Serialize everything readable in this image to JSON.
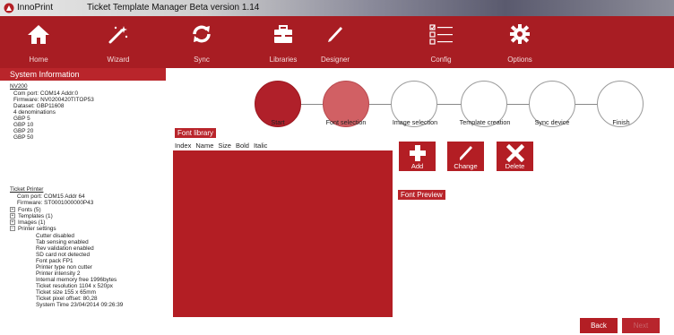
{
  "titlebar": {
    "app_name": "InnoPrint",
    "window_title": "Ticket Template Manager Beta version 1.14"
  },
  "toolbar": {
    "items": [
      {
        "label": "Home",
        "icon": "home-icon"
      },
      {
        "label": "Wizard",
        "icon": "wand-icon"
      },
      {
        "label": "Sync",
        "icon": "sync-icon"
      },
      {
        "label": "Libraries",
        "icon": "toolbox-icon"
      },
      {
        "label": "Designer",
        "icon": "pen-icon"
      },
      {
        "label": "Config",
        "icon": "checklist-icon"
      },
      {
        "label": "Options",
        "icon": "gear-icon"
      }
    ]
  },
  "system_info": {
    "header": "System Information",
    "nv": {
      "title": "NV200",
      "lines": [
        "Com port: COM14 Addr:0",
        "Firmware: NV0200420TITOP53",
        "Dataset: GBP11608",
        "4 denominations",
        "GBP 5",
        "GBP 10",
        "GBP 20",
        "GBP 50"
      ]
    },
    "printer": {
      "title": "Ticket Printer",
      "lines": [
        "Com port: COM15 Addr 64",
        "Firmware: ST0001000000P43"
      ],
      "tree": [
        {
          "label": "Fonts (5)",
          "expander": "+"
        },
        {
          "label": "Templates (1)",
          "expander": "+"
        },
        {
          "label": "Images (1)",
          "expander": "+"
        },
        {
          "label": "Printer settings",
          "expander": "−"
        }
      ],
      "settings": [
        "Cutter disabled",
        "Tab sensing enabled",
        "Rev validation enabled",
        "SD card not detected",
        "Font pack FP1",
        "Printer type non cutter",
        "Printer intensity 2",
        "Internal memory free 1996bytes",
        "Ticket resolution 1104 x 520px",
        "Ticket size 155 x 65mm",
        "Ticket pixel offset: 80,28",
        "System Time 23/04/2014 09:26:39"
      ]
    }
  },
  "wizard_steps": [
    {
      "label": "Start",
      "state": "done"
    },
    {
      "label": "Font selection",
      "state": "active"
    },
    {
      "label": "Image selection",
      "state": "pending"
    },
    {
      "label": "Template creation",
      "state": "pending"
    },
    {
      "label": "Sync device",
      "state": "pending"
    },
    {
      "label": "Finish",
      "state": "pending"
    }
  ],
  "font_library": {
    "title": "Font library",
    "columns": [
      "Index",
      "Name",
      "Size",
      "Bold",
      "Italic"
    ],
    "rows": []
  },
  "actions": {
    "add": "Add",
    "change": "Change",
    "delete": "Delete"
  },
  "font_preview": {
    "title": "Font Preview"
  },
  "nav": {
    "back": "Back",
    "next": "Next"
  },
  "colors": {
    "accent": "#a81d23",
    "active_step": "#d16064",
    "panel_header": "#b9252b"
  }
}
